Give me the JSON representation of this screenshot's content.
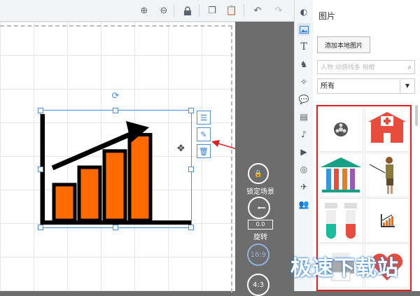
{
  "toolbar": {
    "icons": [
      "zoom-in-icon",
      "zoom-out-icon",
      "lock-icon",
      "copy-icon",
      "paste-icon",
      "undo-icon",
      "redo-icon"
    ]
  },
  "canvas": {
    "chart_bars": [
      0.33,
      0.49,
      0.64,
      0.79
    ]
  },
  "right_controls": {
    "lock_scene_label": "锁定场景",
    "rotation_value": "0.0",
    "rotation_label": "旋转",
    "ratio_169": "16:9",
    "ratio_43": "4:3"
  },
  "panel": {
    "title": "图片",
    "add_button": "添加本地图片",
    "search_placeholder": "人物 动感线条 相框",
    "filter_value": "所有"
  },
  "watermark": "极速下载站"
}
